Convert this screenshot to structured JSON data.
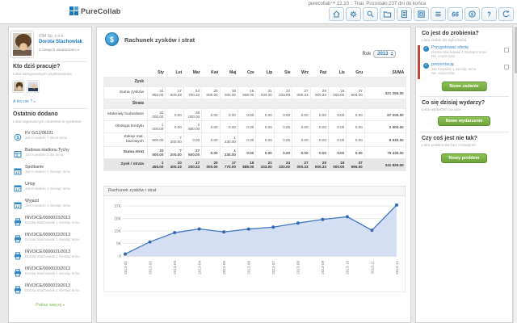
{
  "app": {
    "logo": "PureCollab",
    "trial": "purecollab™ 12.10 :: Trial. Pozostało 237 dni do końca",
    "toolbar": [
      {
        "icon": "home-icon"
      },
      {
        "icon": "gear-icon"
      },
      {
        "icon": "search-icon"
      },
      {
        "icon": "folder-icon"
      },
      {
        "icon": "document-icon"
      },
      {
        "icon": "archive-icon"
      },
      {
        "icon": "list-icon"
      },
      {
        "icon": "quotes-icon"
      },
      {
        "icon": "finance-icon"
      },
      {
        "icon": "help-icon"
      },
      {
        "icon": "undo-icon"
      }
    ]
  },
  "sidebar": {
    "profile": {
      "company": "IDM Sp. z o.o.",
      "name": "Dorota Stachowiak",
      "messages": "2 nowych wiadomości"
    },
    "working": {
      "title": "Kto dziś pracuje?",
      "subtitle": "Lista zalogowanych użytkowników",
      "who_not_link": "A kto nie ?"
    },
    "recent": {
      "title": "Ostatnio dodano",
      "subtitle": "Lista najnowszych obiektów w systemie",
      "items": [
        {
          "icon": "coin-icon",
          "title": "FV G/12/06221",
          "meta": "Jan Kowalski 7 minut temu"
        },
        {
          "icon": "project-icon",
          "title": "Budowa stadionu Tychy",
          "meta": "Jan Kowalski 5 dni temu"
        },
        {
          "icon": "calendar-icon",
          "title": "Spotkanie",
          "meta": "Jan Kowalski 1 miesiąc temu"
        },
        {
          "icon": "calendar-icon",
          "title": "Urlop",
          "meta": "Jan Kowalski 1 miesiąc temu"
        },
        {
          "icon": "calendar-icon",
          "title": "Wyjazd",
          "meta": "Jan Kowalski 1 miesiąc temu"
        },
        {
          "icon": "invoice-icon",
          "title": "INVOICE/0000023/2013",
          "meta": "Dorota Stachowiak 1 miesiąc temu"
        },
        {
          "icon": "invoice-icon",
          "title": "INVOICE/0000022/2013",
          "meta": "Dorota Stachowiak 1 miesiąc temu"
        },
        {
          "icon": "invoice-icon",
          "title": "INVOICE/0000021/2013",
          "meta": "Dorota Stachowiak 1 miesiąc temu"
        },
        {
          "icon": "invoice-icon",
          "title": "INVOICE/0000020/2013",
          "meta": "Dorota Stachowiak 1 miesiąc temu"
        },
        {
          "icon": "invoice-icon",
          "title": "INVOICE/0000019/2013",
          "meta": "Dorota Stachowiak 1 miesiąc temu"
        }
      ],
      "more_link": "Pokaż więcej"
    }
  },
  "main": {
    "title": "Rachunek zysków i strat",
    "year_label": "Rok",
    "year": "2013",
    "table": {
      "columns": [
        "Sty",
        "Lut",
        "Mar",
        "Kwi",
        "Maj",
        "Cze",
        "Lip",
        "Sie",
        "Wrz",
        "Paź",
        "Lis",
        "Gru",
        "SUMA"
      ],
      "rows": [
        {
          "label": "Zysk",
          "type": "section"
        },
        {
          "label": "Suma zysków",
          "type": "data",
          "values": [
            "34 955.00",
            "17 600.33",
            "54 700.33",
            "20 000.00",
            "19 000.00",
            "19 888.00",
            "21 333.00",
            "24 333.00",
            "27 000.33",
            "29 000.33",
            "19 000.00",
            "37 666.00",
            "321 255.00"
          ]
        },
        {
          "label": "Strata",
          "type": "section"
        },
        {
          "label": "Materiały budowlane",
          "type": "data",
          "values": [
            "32 000.00",
            "0.00",
            "35 000.00",
            "0.00",
            "0.00",
            "0.00",
            "0.00",
            "0.00",
            "0.00",
            "0.00",
            "0.00",
            "0.00",
            "67 000.00"
          ]
        },
        {
          "label": "Obsługa kredytu",
          "type": "data",
          "values": [
            "1 000.00",
            "0.00",
            "2 500.00",
            "0.00",
            "0.00",
            "0.00",
            "0.00",
            "0.00",
            "0.00",
            "0.00",
            "0.00",
            "0.00",
            "3 500.00"
          ]
        },
        {
          "label": "Zakup mat. biurowych",
          "type": "data",
          "values": [
            "500.00",
            "7 200.00",
            "0.00",
            "0.00",
            "1 230.00",
            "0.00",
            "0.00",
            "0.00",
            "0.00",
            "0.00",
            "0.00",
            "0.00",
            "8 930.00"
          ]
        },
        {
          "label": "Suma strat",
          "type": "total",
          "values": [
            "33 500.00",
            "7 200.00",
            "37 500.00",
            "0.00",
            "1 230.00",
            "0.00",
            "0.00",
            "0.00",
            "0.00",
            "0.00",
            "0.00",
            "0.00",
            "79 430.00"
          ]
        },
        {
          "label": "Zysk / strata",
          "type": "grand",
          "values": [
            "1 455.00",
            "10 400.33",
            "17 200.33",
            "20 000.00",
            "17 770.00",
            "19 888.00",
            "21 333.00",
            "24 333.00",
            "27 000.33",
            "29 000.33",
            "19 000.00",
            "37 666.00",
            "241 825.00"
          ]
        }
      ]
    },
    "chart_header": "Rachunek zysków i strat"
  },
  "chart_data": {
    "type": "area",
    "title": "Rachunek zysków i strat",
    "x": [
      "2013-01",
      "2013-02",
      "2013-03",
      "2013-04",
      "2013-05",
      "2013-06",
      "2013-07",
      "2013-08",
      "2013-09",
      "2013-10",
      "2013-11",
      "2013-12"
    ],
    "series": [
      {
        "name": "Zysk / strata",
        "values": [
          1455,
          10400,
          17200,
          20000,
          17770,
          19888,
          21333,
          24333,
          27000,
          29000,
          19000,
          37666
        ]
      }
    ],
    "ylim": [
      0,
      37000
    ],
    "yticks": [
      {
        "v": 0,
        "label": "0"
      },
      {
        "v": 9250,
        "label": "9K"
      },
      {
        "v": 18500,
        "label": "19K"
      },
      {
        "v": 27750,
        "label": "28K"
      },
      {
        "v": 37000,
        "label": "37K"
      }
    ],
    "grid": true,
    "legend": "none",
    "line_color": "#4176c4",
    "fill_color": "#cdd9f1",
    "point_color": "#3468b0"
  },
  "panel": {
    "todo": {
      "title": "Co jest do zrobienia?",
      "subtitle": "Lista zadań do wykonania",
      "tasks": [
        {
          "title": "Przygotować ofertę",
          "meta": "Dorota Stachowiak 4 miesiące temu",
          "status": "Nie rozpoczęta"
        },
        {
          "title": "prezentację",
          "meta": "Jan Kowalski 1 miesiąc temu",
          "status": "Nie rozpoczęta"
        }
      ],
      "button": "Nowe zadanie"
    },
    "events": {
      "title": "Co się dzisiaj wydarzy?",
      "subtitle": "Lista wydarzeń na dziś",
      "button": "Nowe wydarzenie"
    },
    "problems": {
      "title": "Czy coś jest nie tak?",
      "subtitle": "Lista problemów bez rozwiązań",
      "button": "Nowy problem"
    }
  }
}
